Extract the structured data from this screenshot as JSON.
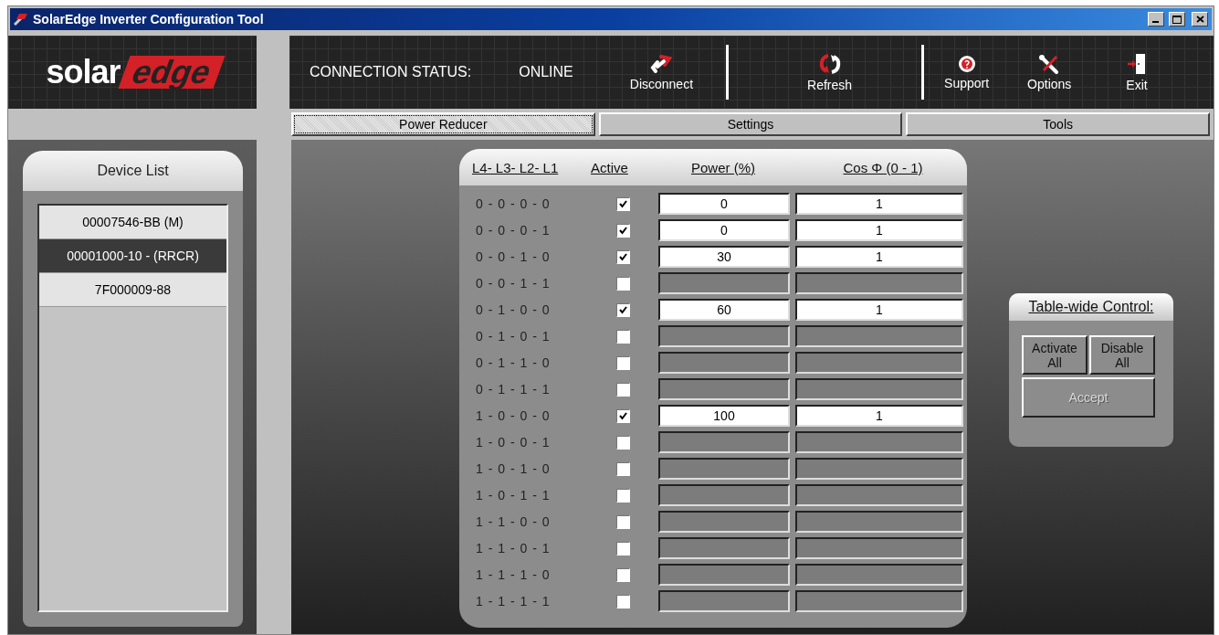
{
  "window": {
    "title": "SolarEdge Inverter Configuration Tool"
  },
  "logo": {
    "part_1": "solar",
    "part_2": "edge"
  },
  "connection": {
    "label": "CONNECTION STATUS:",
    "value": "ONLINE"
  },
  "toolbar": [
    {
      "label": "Disconnect",
      "kind": "link"
    },
    {
      "label": "Refresh",
      "kind": "refresh"
    },
    {
      "label": "Support",
      "kind": "support"
    },
    {
      "label": "Options",
      "kind": "options"
    },
    {
      "label": "Exit",
      "kind": "exit"
    }
  ],
  "tabs": [
    {
      "label": "Power Reducer",
      "selected": true
    },
    {
      "label": "Settings",
      "selected": false
    },
    {
      "label": "Tools",
      "selected": false
    }
  ],
  "device_list": {
    "title": "Device List",
    "items": [
      {
        "label": "00007546-BB (M)",
        "selected": false
      },
      {
        "label": "00001000-10 - (RRCR)",
        "selected": true
      },
      {
        "label": "7F000009-88",
        "selected": false
      }
    ]
  },
  "table": {
    "columns": [
      "L4- L3- L2- L1",
      "Active",
      "Power (%)",
      "Cos Φ (0 - 1)"
    ],
    "rows": [
      {
        "code": "0 - 0 - 0 - 0",
        "active": true,
        "power": "0",
        "cos": "1"
      },
      {
        "code": "0 - 0 - 0 - 1",
        "active": true,
        "power": "0",
        "cos": "1"
      },
      {
        "code": "0 - 0 - 1 - 0",
        "active": true,
        "power": "30",
        "cos": "1"
      },
      {
        "code": "0 - 0 - 1 - 1",
        "active": false
      },
      {
        "code": "0 - 1 - 0 - 0",
        "active": true,
        "power": "60",
        "cos": "1"
      },
      {
        "code": "0 - 1 - 0 - 1",
        "active": false
      },
      {
        "code": "0 - 1 - 1 - 0",
        "active": false
      },
      {
        "code": "0 - 1 - 1 - 1",
        "active": false
      },
      {
        "code": "1 - 0 - 0 - 0",
        "active": true,
        "power": "100",
        "cos": "1"
      },
      {
        "code": "1 - 0 - 0 - 1",
        "active": false
      },
      {
        "code": "1 - 0 - 1 - 0",
        "active": false
      },
      {
        "code": "1 - 0 - 1 - 1",
        "active": false
      },
      {
        "code": "1 - 1 - 0 - 0",
        "active": false
      },
      {
        "code": "1 - 1 - 0 - 1",
        "active": false
      },
      {
        "code": "1 - 1 - 1 - 0",
        "active": false
      },
      {
        "code": "1 - 1 - 1 - 1",
        "active": false
      }
    ]
  },
  "table_wide_control": {
    "title": "Table-wide Control:",
    "buttons": [
      {
        "label": "Activate All",
        "disabled": false
      },
      {
        "label": "Disable All",
        "disabled": false
      },
      {
        "label": "Accept",
        "disabled": true
      }
    ]
  }
}
